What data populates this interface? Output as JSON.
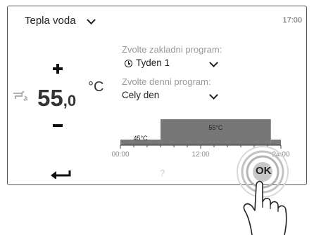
{
  "header": {
    "title": "Tepla voda",
    "time": "17:00"
  },
  "temperature": {
    "integer": "55",
    "decimal": ",0",
    "unit": "°C"
  },
  "base_program": {
    "label": "Zvolte zakladni program:",
    "value": "Tyden 1"
  },
  "daily_program": {
    "label": "Zvolte denni program:",
    "value": "Cely den"
  },
  "footer": {
    "help": "?",
    "ok": "OK"
  },
  "icons": {
    "plus": "plus-icon",
    "minus": "minus-icon",
    "tap": "water-tap-icon",
    "clock": "clock-icon",
    "back": "back-arrow-icon",
    "chevron": "chevron-down-icon"
  },
  "colors": {
    "bar": "#777777",
    "label_grey": "#999999",
    "ring": "#c8c8c8"
  },
  "chart_data": {
    "type": "area",
    "x_ticks": [
      "00:00",
      "12:00",
      "24:00"
    ],
    "xlim": [
      0,
      24
    ],
    "segments": [
      {
        "start": 0,
        "end": 6,
        "value": 45,
        "label": "45°C"
      },
      {
        "start": 6,
        "end": 22.5,
        "value": 55,
        "label": "55°C"
      },
      {
        "start": 22.5,
        "end": 24,
        "value": 45,
        "label": ""
      }
    ]
  }
}
